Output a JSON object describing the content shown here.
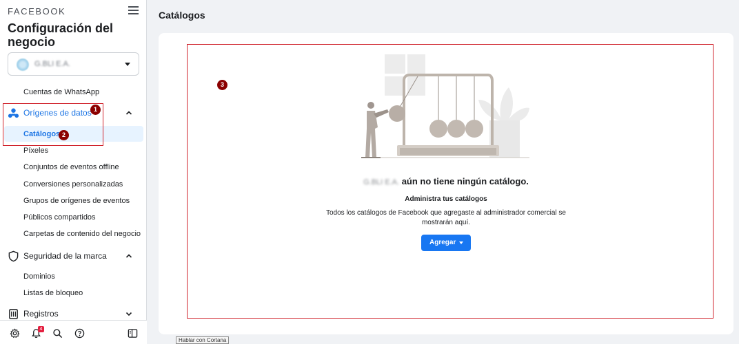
{
  "sidebar": {
    "brand": "FACEBOOK",
    "title": "Configuración del negocio",
    "business_name": "G.BLI E.A.",
    "items": {
      "whatsapp": "Cuentas de WhatsApp",
      "data_sources": "Orígenes de datos",
      "catalogs": "Catálogos",
      "pixels": "Píxeles",
      "offline_events": "Conjuntos de eventos offline",
      "custom_conversions": "Conversiones personalizadas",
      "event_source_groups": "Grupos de orígenes de eventos",
      "shared_audiences": "Públicos compartidos",
      "content_folders": "Carpetas de contenido del negocio",
      "brand_safety": "Seguridad de la marca",
      "domains": "Dominios",
      "block_lists": "Listas de bloqueo",
      "registers": "Registros"
    },
    "notification_count": "4"
  },
  "annotations": [
    "1",
    "2",
    "3"
  ],
  "main": {
    "page_title": "Catálogos",
    "empty_business": "G.BLI E.A.",
    "empty_title": "aún no tiene ningún catálogo.",
    "subtitle": "Administra tus catálogos",
    "description": "Todos los catálogos de Facebook que agregaste al administrador comercial se mostrarán aquí.",
    "add_button": "Agregar"
  },
  "tooltip": "Hablar con Cortana",
  "colors": {
    "accent": "#1877f2",
    "active_text": "#1b74e4",
    "annotation_red": "#d0212a",
    "marker": "#8b0000"
  }
}
